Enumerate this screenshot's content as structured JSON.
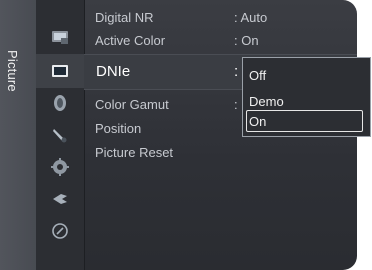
{
  "side_tab": {
    "label": "Picture"
  },
  "icons": [
    {
      "name": "input-source-icon"
    },
    {
      "name": "picture-icon"
    },
    {
      "name": "sound-icon"
    },
    {
      "name": "channel-icon"
    },
    {
      "name": "setup-icon"
    },
    {
      "name": "application-icon"
    },
    {
      "name": "support-icon"
    }
  ],
  "menu": {
    "digital_nr": {
      "label": "Digital NR",
      "value": ": Auto"
    },
    "active_color": {
      "label": "Active Color",
      "value": ": On"
    },
    "dnie": {
      "label": "DNIe",
      "value": ":"
    },
    "color_gamut": {
      "label": "Color Gamut",
      "value": ":"
    },
    "position": {
      "label": "Position"
    },
    "picture_reset": {
      "label": "Picture Reset"
    }
  },
  "dropdown": {
    "options": [
      "Off",
      "Demo",
      "On"
    ],
    "selected": "On"
  }
}
